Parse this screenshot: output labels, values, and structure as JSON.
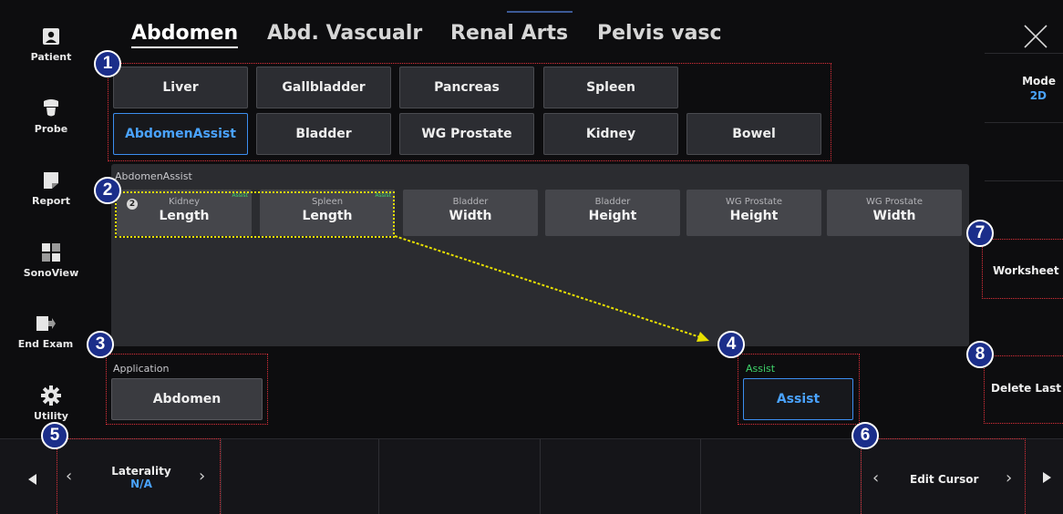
{
  "sidebar": {
    "items": [
      {
        "label": "Patient",
        "icon": "patient-icon"
      },
      {
        "label": "Probe",
        "icon": "probe-icon"
      },
      {
        "label": "Report",
        "icon": "report-icon"
      },
      {
        "label": "SonoView",
        "icon": "sonoview-icon"
      },
      {
        "label": "End Exam",
        "icon": "end-exam-icon"
      },
      {
        "label": "Utility",
        "icon": "gear-icon"
      }
    ]
  },
  "tabs": [
    {
      "label": "Abdomen",
      "active": true
    },
    {
      "label": "Abd. Vascualr",
      "active": false
    },
    {
      "label": "Renal Arts",
      "active": false
    },
    {
      "label": "Pelvis vasc",
      "active": false
    }
  ],
  "presets": {
    "row1": [
      "Liver",
      "Gallbladder",
      "Pancreas",
      "Spleen"
    ],
    "row2": [
      "AbdomenAssist",
      "Bladder",
      "WG Prostate",
      "Kidney",
      "Bowel"
    ],
    "active": "AbdomenAssist"
  },
  "measure_panel": {
    "title": "AbdomenAssist",
    "count_badge": "2",
    "items": [
      {
        "sub": "Kidney",
        "main": "Length",
        "tag": "Assist"
      },
      {
        "sub": "Spleen",
        "main": "Length",
        "tag": "Assist"
      },
      {
        "sub": "Bladder",
        "main": "Width",
        "tag": ""
      },
      {
        "sub": "Bladder",
        "main": "Height",
        "tag": ""
      },
      {
        "sub": "WG Prostate",
        "main": "Height",
        "tag": ""
      },
      {
        "sub": "WG Prostate",
        "main": "Width",
        "tag": ""
      }
    ]
  },
  "application": {
    "label": "Application",
    "value": "Abdomen"
  },
  "assist": {
    "label": "Assist",
    "button": "Assist"
  },
  "right_panel": {
    "close_icon": "close-icon",
    "mode_label": "Mode",
    "mode_value": "2D",
    "worksheet": "Worksheet",
    "delete_last": "Delete Last"
  },
  "bottom_bar": {
    "laterality_label": "Laterality",
    "laterality_value": "N/A",
    "edit_cursor": "Edit Cursor"
  },
  "callouts": [
    "1",
    "2",
    "3",
    "4",
    "5",
    "6",
    "7",
    "8"
  ],
  "colors": {
    "accent_blue": "#3c8ef0",
    "assist_green": "#3fd36a",
    "annotation_red": "#e0303a",
    "annotation_yellow": "#e8e000",
    "badge_blue": "#1b2e8a"
  }
}
